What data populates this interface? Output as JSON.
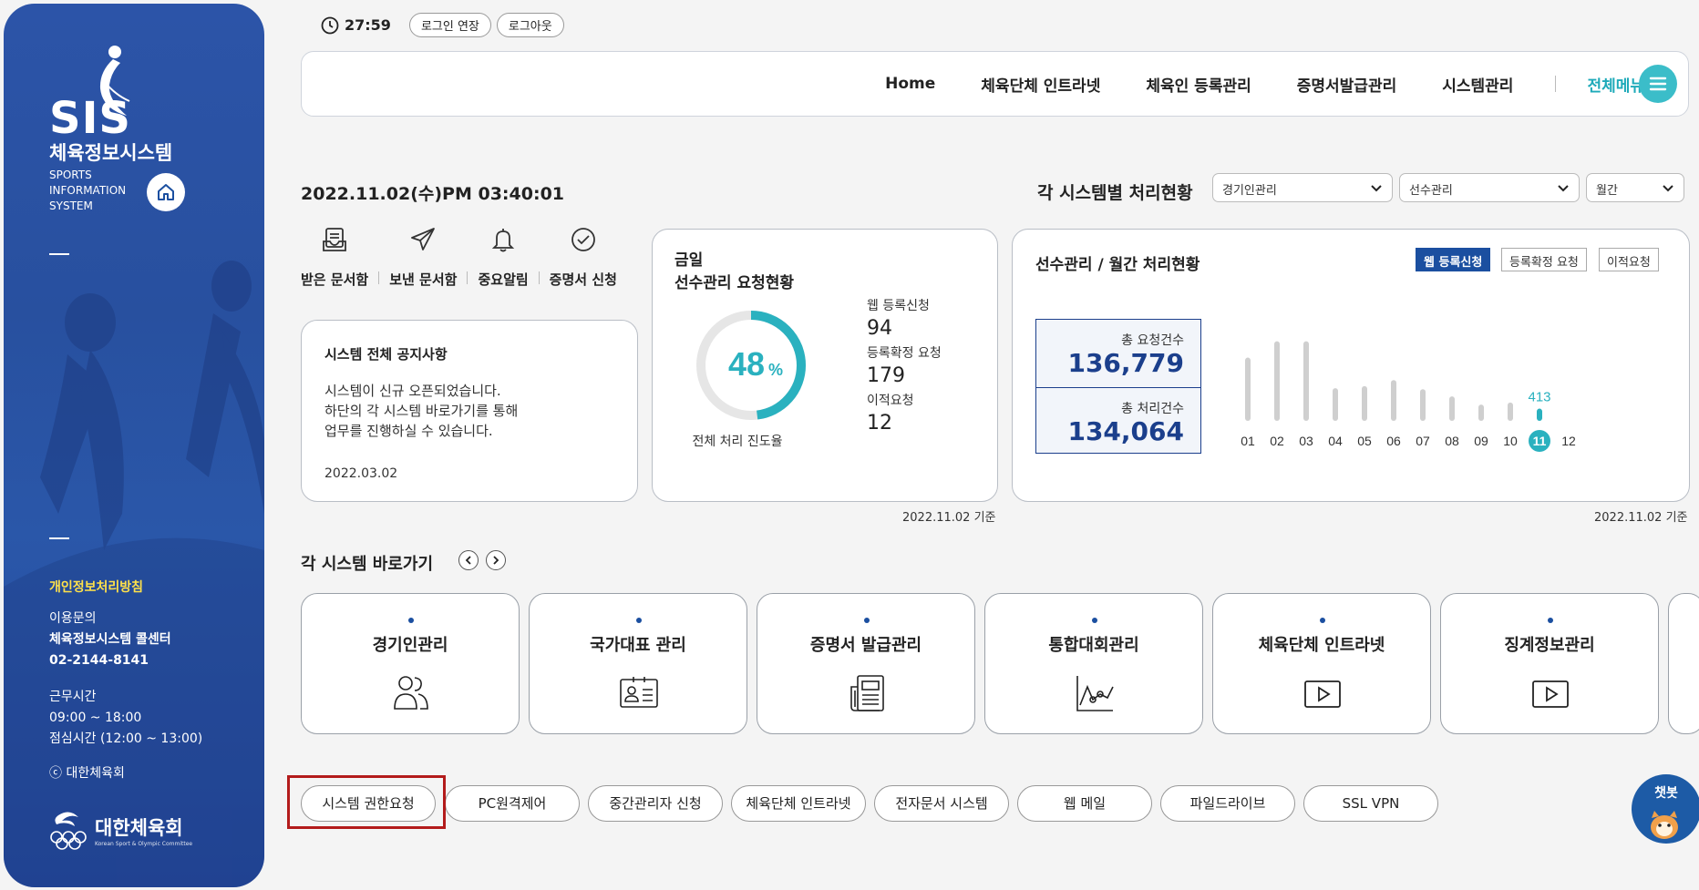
{
  "sidebar": {
    "logo": "SIS",
    "title": "체육정보시스템",
    "sub": [
      "SPORTS",
      "INFORMATION",
      "SYSTEM"
    ],
    "privacy": "개인정보처리방침",
    "inquiry": [
      "이용문의",
      "체육정보시스템 콜센터",
      "02-2144-8141"
    ],
    "hours": [
      "근무시간",
      "09:00 ~ 18:00",
      "점심시간 (12:00 ~ 13:00)"
    ],
    "copyright": "ⓒ 대한체육회",
    "org_name": "대한체육회",
    "org_en": "Korean Sport & Olympic Committee"
  },
  "session": {
    "timer": "27:59",
    "extend": "로그인 연장",
    "logout": "로그아웃"
  },
  "nav": {
    "items": [
      "Home",
      "체육단체 인트라넷",
      "체육인 등록관리",
      "증명서발급관리",
      "시스템관리"
    ],
    "all_menu": "전체메뉴"
  },
  "datetime": "2022.11.02(수)PM 03:40:01",
  "processing": {
    "title": "각 시스템별 처리현황",
    "selects": [
      "경기인관리",
      "선수관리",
      "월간"
    ]
  },
  "quick": [
    "받은 문서함",
    "보낸 문서함",
    "중요알림",
    "증명서 신청"
  ],
  "notice": {
    "title": "시스템 전체 공지사항",
    "body": [
      "시스템이 신규 오픈되었습니다.",
      "하단의 각 시스템 바로가기를 통해",
      "업무를 진행하실 수 있습니다."
    ],
    "date": "2022.03.02"
  },
  "today": {
    "title1": "금일",
    "title2": "선수관리 요청현황",
    "percent": "48",
    "percent_unit": "%",
    "progress": 0.48,
    "progress_label": "전체 처리 진도율",
    "requests": [
      {
        "label": "웹 등록신청",
        "value": "94"
      },
      {
        "label": "등록확정 요청",
        "value": "179"
      },
      {
        "label": "이적요청",
        "value": "12"
      }
    ],
    "basis": "2022.11.02 기준"
  },
  "monthly": {
    "title": "선수관리 / 월간 처리현황",
    "tabs": [
      "웹 등록신청",
      "등록확정 요청",
      "이적요청"
    ],
    "total_req_label": "총 요청건수",
    "total_req": "136,779",
    "total_proc_label": "총 처리건수",
    "total_proc": "134,064",
    "basis": "2022.11.02 기준"
  },
  "chart_data": {
    "type": "bar",
    "categories": [
      "01",
      "02",
      "03",
      "04",
      "05",
      "06",
      "07",
      "08",
      "09",
      "10",
      "11",
      "12"
    ],
    "values": [
      null,
      null,
      null,
      null,
      null,
      null,
      null,
      null,
      null,
      null,
      413,
      null
    ],
    "highlight": "11",
    "highlight_label": "413",
    "accent": "#2ab1bf"
  },
  "shortcuts": {
    "title": "각 시스템 바로가기",
    "items": [
      "경기인관리",
      "국가대표 관리",
      "증명서 발급관리",
      "통합대회관리",
      "체육단체 인트라넷",
      "징계정보관리"
    ]
  },
  "bottom": [
    "시스템 권한요청",
    "PC원격제어",
    "중간관리자 신청",
    "체육단체 인트라넷",
    "전자문서 시스템",
    "웹 메일",
    "파일드라이브",
    "SSL VPN"
  ],
  "chatbot": "챗봇",
  "colors": {
    "primary": "#1b4fa0",
    "accent": "#2ab1bf",
    "highlight_box": "#b31b1b"
  }
}
